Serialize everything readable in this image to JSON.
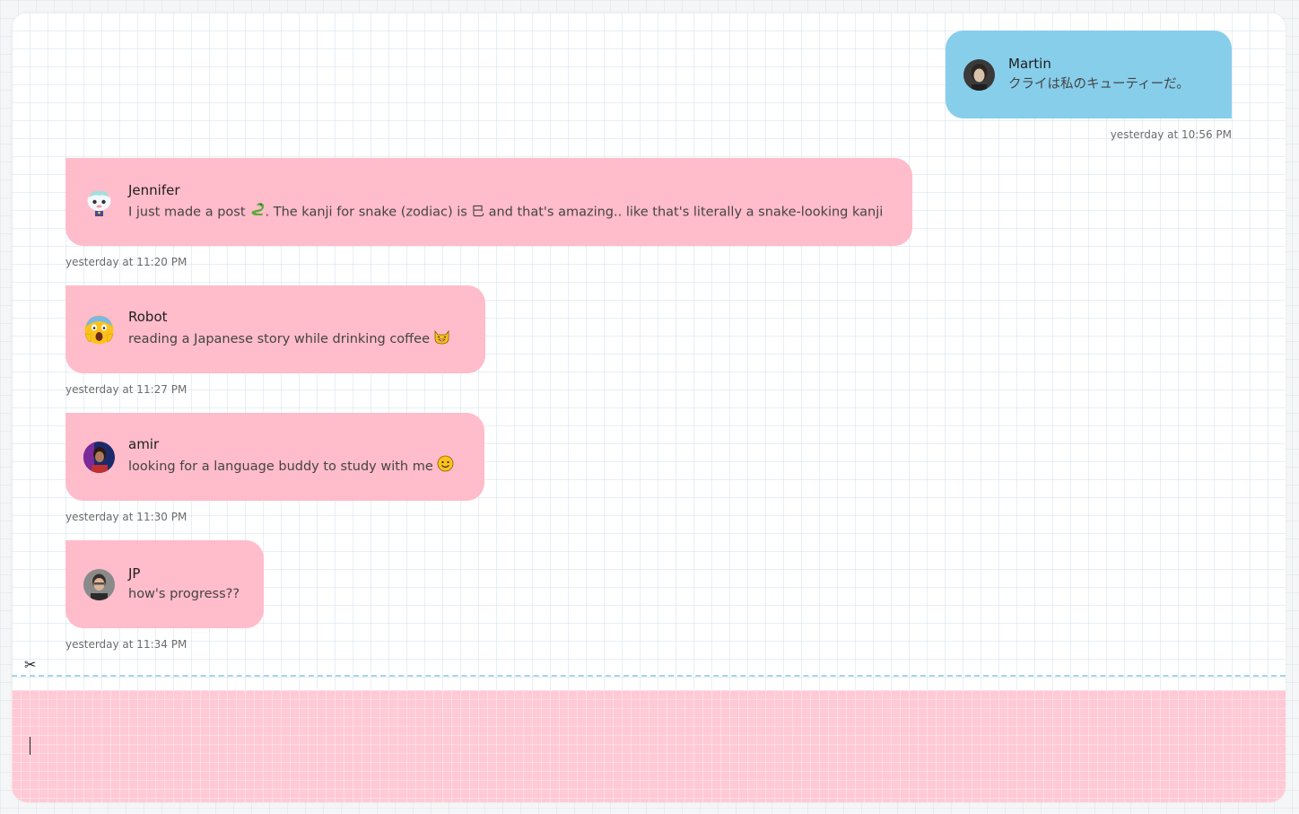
{
  "messages": [
    {
      "sender": "Martin",
      "text": "クライは私のキューティーだ。",
      "timestamp": "yesterday at 10:56 PM",
      "side": "right",
      "bubble_color": "#87ceeb",
      "avatar_icon": "person-photo-avatar"
    },
    {
      "sender": "Jennifer",
      "text_before": "I just made a post",
      "text_after": ". The kanji for snake (zodiac) is 巳 and that's amazing.. like that's literally a snake-looking kanji",
      "inline_emoji": "snake-emoji",
      "timestamp": "yesterday at 11:20 PM",
      "side": "left",
      "bubble_color": "#ffbccb",
      "avatar_icon": "villager-character-avatar"
    },
    {
      "sender": "Robot",
      "text": "reading a Japanese story while drinking coffee",
      "inline_emoji": "cat-smiling-emoji",
      "timestamp": "yesterday at 11:27 PM",
      "side": "left",
      "bubble_color": "#ffbccb",
      "avatar_icon": "screaming-face-emoji-avatar"
    },
    {
      "sender": "amir",
      "text": "looking for a language buddy to study with me",
      "inline_emoji": "smiling-face-emoji",
      "timestamp": "yesterday at 11:30 PM",
      "side": "left",
      "bubble_color": "#ffbccb",
      "avatar_icon": "person-photo-avatar"
    },
    {
      "sender": "JP",
      "text": "how's progress??",
      "timestamp": "yesterday at 11:34 PM",
      "side": "left",
      "bubble_color": "#ffbccb",
      "avatar_icon": "person-photo-avatar"
    }
  ],
  "composer": {
    "value": "",
    "placeholder": "",
    "background_color": "#ffc9d5"
  },
  "divider_icon": "scissors-icon",
  "divider_glyph": "✂"
}
